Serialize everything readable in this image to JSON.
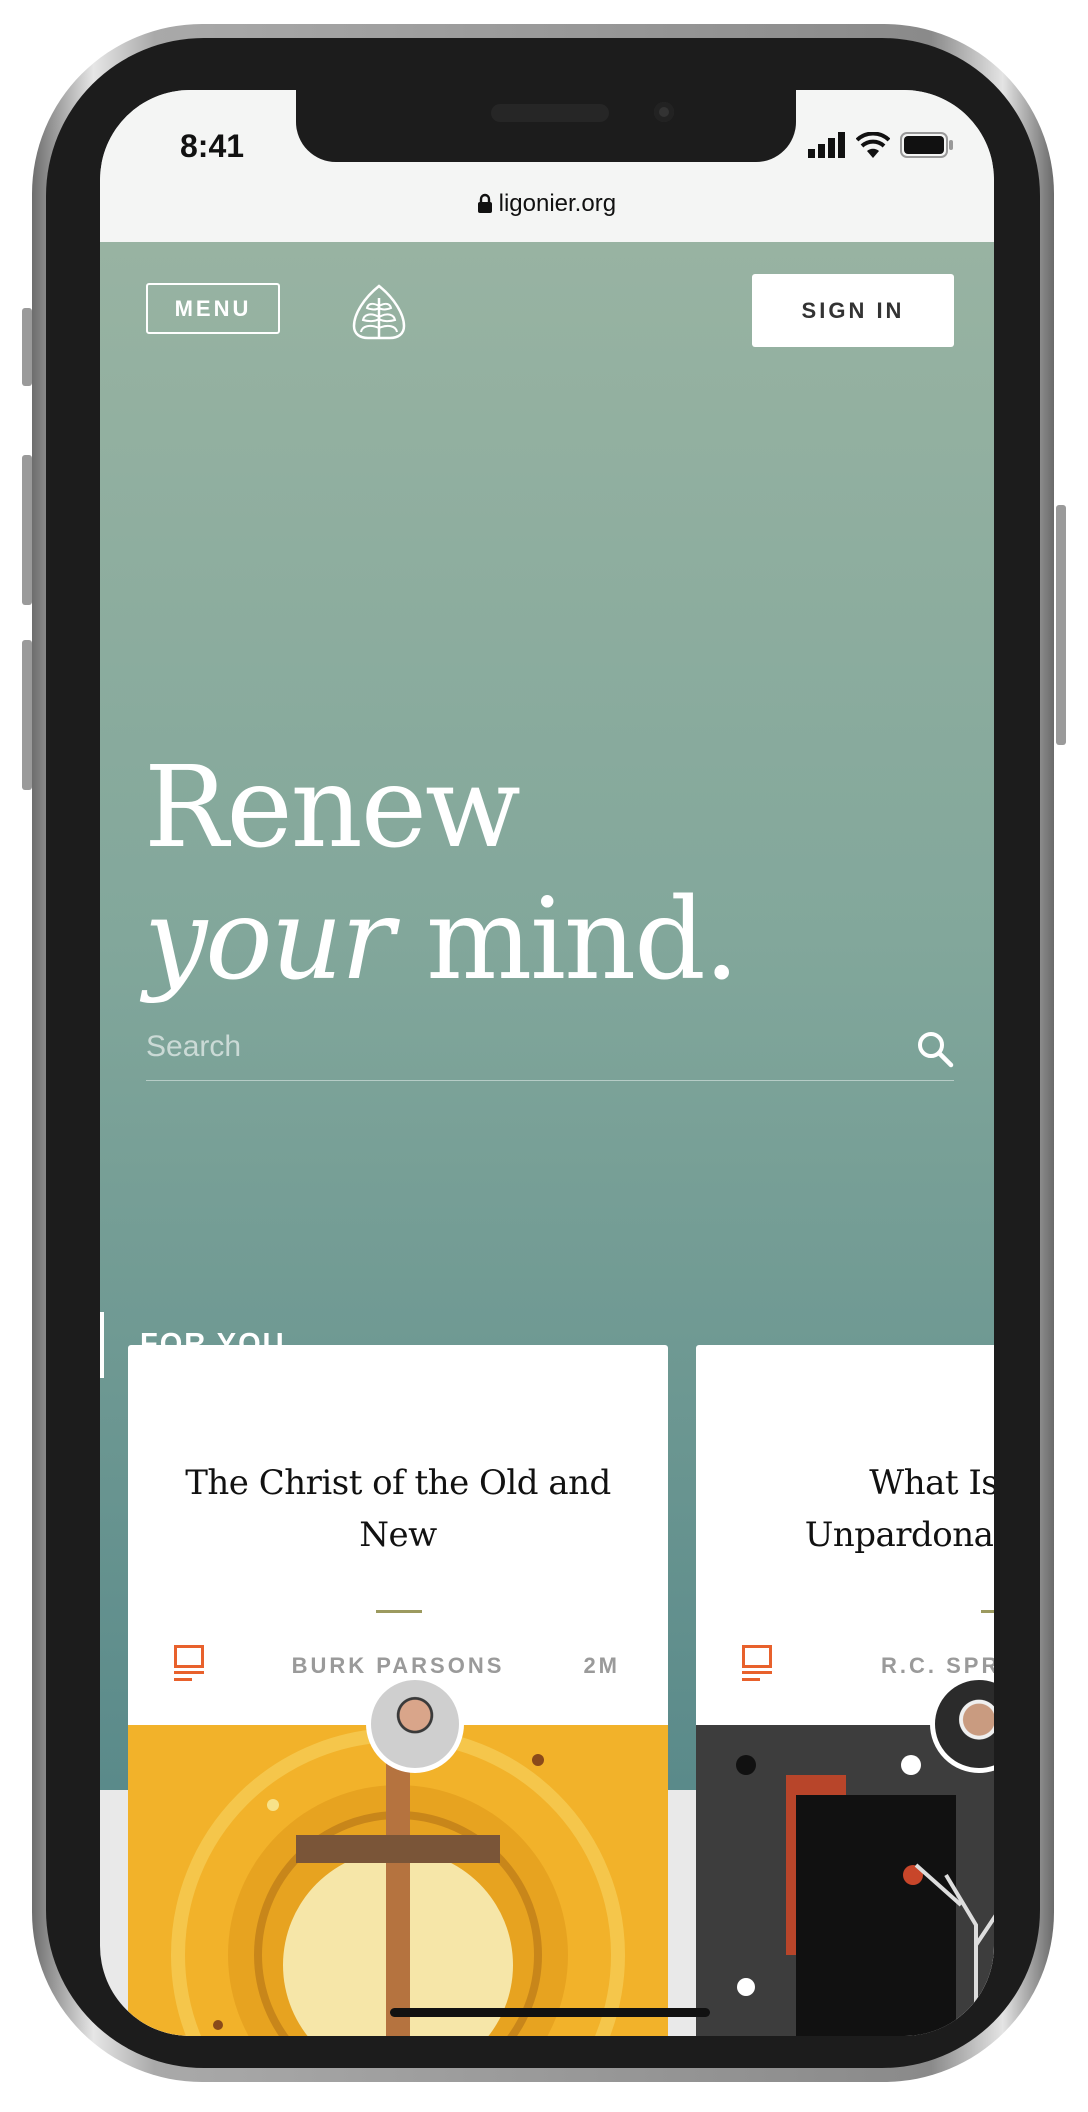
{
  "status_bar": {
    "time": "8:41",
    "icons": [
      "signal-icon",
      "wifi-icon",
      "battery-icon"
    ]
  },
  "browser": {
    "url": "ligonier.org",
    "lock_icon": "lock-icon"
  },
  "header": {
    "menu_label": "MENU",
    "logo_icon": "ligonier-leaf-logo",
    "sign_in_label": "SIGN IN"
  },
  "hero": {
    "line1": "Renew",
    "line2_italic": "your",
    "line2_rest": " mind.",
    "colors": {
      "top": "#98b3a2",
      "bottom": "#5a8a8a"
    }
  },
  "search": {
    "placeholder": "Search",
    "value": "",
    "icon": "search-icon"
  },
  "section": {
    "title": "FOR YOU"
  },
  "cards": [
    {
      "title": "The Christ of the Old and New",
      "author": "BURK PARSONS",
      "duration": "2M",
      "type_icon": "video-icon"
    },
    {
      "title": "What Is the Unpardonable Sin?",
      "title_visible_line1": "What Is",
      "title_visible_line2": "Unpardona",
      "author": "R.C. SPR",
      "type_icon": "video-icon"
    }
  ],
  "accent": "#e8612c"
}
